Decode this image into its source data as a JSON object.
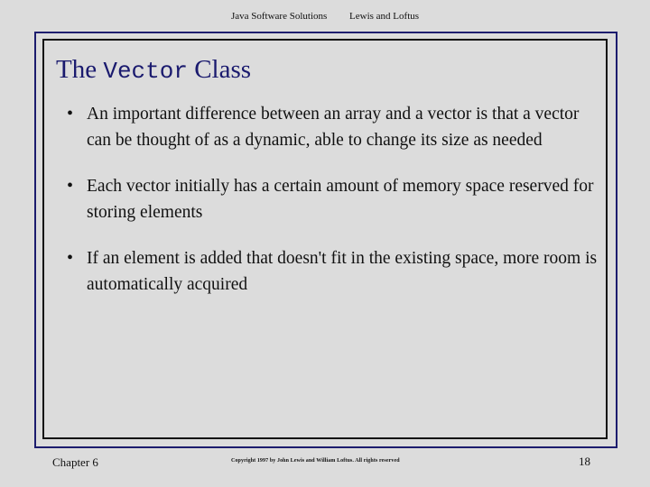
{
  "colors": {
    "background": "#dcdcdc",
    "outer_frame": "#1c1c6e",
    "inner_frame": "#121212",
    "title_text": "#1a1a6e",
    "body_text": "#111111"
  },
  "header": {
    "left": "Java Software Solutions",
    "right": "Lewis and Loftus"
  },
  "title": {
    "prefix": "The ",
    "code": "Vector",
    "suffix": " Class"
  },
  "bullets": [
    {
      "marker": "•",
      "text": "An important difference between an array and a vector is that a vector can be thought of as a dynamic, able to change its size as needed"
    },
    {
      "marker": "•",
      "text": "Each vector initially has a certain amount of memory space reserved for storing elements"
    },
    {
      "marker": "•",
      "text": "If an element is added that doesn't fit in the existing space, more room is automatically acquired"
    }
  ],
  "footer": {
    "chapter": "Chapter 6",
    "copyright": "Copyright 1997 by John Lewis and William Loftus.  All rights reserved",
    "page_number": "18"
  }
}
